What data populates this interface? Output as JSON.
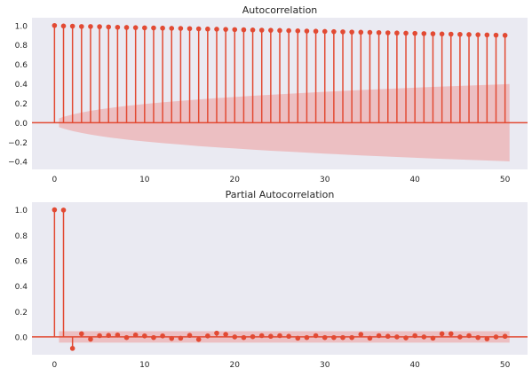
{
  "chart_data": [
    {
      "type": "stem",
      "title": "Autocorrelation",
      "xlabel": "",
      "ylabel": "",
      "xlim": [
        -2.5,
        52.5
      ],
      "ylim": [
        -0.48,
        1.08
      ],
      "x_ticks": [
        "0",
        "10",
        "20",
        "30",
        "40",
        "50"
      ],
      "x_tick_values": [
        0,
        10,
        20,
        30,
        40,
        50
      ],
      "y_ticks": [
        "1.0",
        "0.8",
        "0.6",
        "0.4",
        "0.2",
        "0.0",
        "−0.2",
        "−0.4"
      ],
      "y_tick_values": [
        1.0,
        0.8,
        0.6,
        0.4,
        0.2,
        0.0,
        -0.2,
        -0.4
      ],
      "lags": [
        0,
        1,
        2,
        3,
        4,
        5,
        6,
        7,
        8,
        9,
        10,
        11,
        12,
        13,
        14,
        15,
        16,
        17,
        18,
        19,
        20,
        21,
        22,
        23,
        24,
        25,
        26,
        27,
        28,
        29,
        30,
        31,
        32,
        33,
        34,
        35,
        36,
        37,
        38,
        39,
        40,
        41,
        42,
        43,
        44,
        45,
        46,
        47,
        48,
        49,
        50
      ],
      "values": [
        1.0,
        0.995,
        0.993,
        0.99,
        0.99,
        0.988,
        0.985,
        0.982,
        0.98,
        0.978,
        0.976,
        0.975,
        0.973,
        0.971,
        0.97,
        0.968,
        0.966,
        0.964,
        0.962,
        0.96,
        0.958,
        0.956,
        0.954,
        0.952,
        0.951,
        0.949,
        0.947,
        0.945,
        0.943,
        0.941,
        0.939,
        0.937,
        0.935,
        0.933,
        0.931,
        0.929,
        0.927,
        0.925,
        0.923,
        0.921,
        0.919,
        0.917,
        0.915,
        0.913,
        0.911,
        0.909,
        0.907,
        0.905,
        0.903,
        0.901,
        0.899
      ],
      "confidence_band": {
        "x": [
          0.5,
          1,
          2,
          3,
          4,
          5,
          6,
          7,
          8,
          9,
          10,
          12,
          14,
          16,
          18,
          20,
          22,
          24,
          26,
          28,
          30,
          32,
          34,
          36,
          38,
          40,
          42,
          44,
          46,
          48,
          50,
          50.5
        ],
        "upper": [
          0.045,
          0.06,
          0.085,
          0.105,
          0.122,
          0.137,
          0.15,
          0.162,
          0.173,
          0.183,
          0.193,
          0.21,
          0.225,
          0.24,
          0.253,
          0.265,
          0.277,
          0.288,
          0.298,
          0.308,
          0.318,
          0.327,
          0.336,
          0.344,
          0.352,
          0.36,
          0.368,
          0.375,
          0.382,
          0.389,
          0.396,
          0.398
        ]
      },
      "zero_line": 0.0,
      "grid": false,
      "color": "#e24a33",
      "band_color": "#ec9a9a",
      "background": "#eaeaf2"
    },
    {
      "type": "stem",
      "title": "Partial Autocorrelation",
      "xlabel": "",
      "ylabel": "",
      "xlim": [
        -2.5,
        52.5
      ],
      "ylim": [
        -0.14,
        1.06
      ],
      "x_ticks": [
        "0",
        "10",
        "20",
        "30",
        "40",
        "50"
      ],
      "x_tick_values": [
        0,
        10,
        20,
        30,
        40,
        50
      ],
      "y_ticks": [
        "1.0",
        "0.8",
        "0.6",
        "0.4",
        "0.2",
        "0.0"
      ],
      "y_tick_values": [
        1.0,
        0.8,
        0.6,
        0.4,
        0.2,
        0.0
      ],
      "lags": [
        0,
        1,
        2,
        3,
        4,
        5,
        6,
        7,
        8,
        9,
        10,
        11,
        12,
        13,
        14,
        15,
        16,
        17,
        18,
        19,
        20,
        21,
        22,
        23,
        24,
        25,
        26,
        27,
        28,
        29,
        30,
        31,
        32,
        33,
        34,
        35,
        36,
        37,
        38,
        39,
        40,
        41,
        42,
        43,
        44,
        45,
        46,
        47,
        48,
        49,
        50
      ],
      "values": [
        1.0,
        0.998,
        -0.09,
        0.025,
        -0.018,
        0.01,
        0.012,
        0.015,
        -0.005,
        0.015,
        0.008,
        -0.005,
        0.008,
        -0.012,
        -0.01,
        0.012,
        -0.02,
        0.008,
        0.03,
        0.02,
        0.0,
        -0.005,
        0.002,
        0.01,
        0.005,
        0.01,
        0.005,
        -0.01,
        -0.005,
        0.01,
        -0.005,
        -0.005,
        -0.005,
        -0.005,
        0.02,
        -0.01,
        0.01,
        0.005,
        0.0,
        -0.008,
        0.01,
        0.0,
        -0.01,
        0.025,
        0.025,
        0.0,
        0.01,
        -0.005,
        -0.015,
        0.0,
        0.005
      ],
      "confidence_band": {
        "x": [
          0.5,
          50.5
        ],
        "upper": [
          0.045,
          0.045
        ]
      },
      "zero_line": 0.0,
      "grid": false,
      "color": "#e24a33",
      "band_color": "#ec9a9a",
      "background": "#eaeaf2"
    }
  ]
}
